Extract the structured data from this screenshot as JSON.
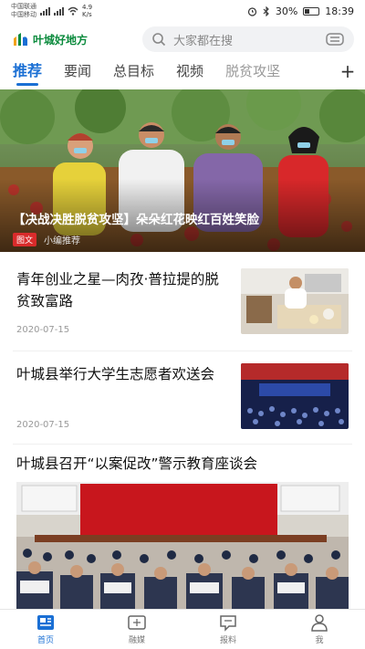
{
  "status_bar": {
    "carrier_top": "中国联通",
    "carrier_bottom": "中国移动",
    "speed": "4.9 K/s",
    "battery": "30%",
    "time": "18:39"
  },
  "header": {
    "logo_text": "叶城好地方",
    "search_placeholder": "大家都在搜"
  },
  "tabs": [
    "推荐",
    "要闻",
    "总目标",
    "视频",
    "脱贫攻坚"
  ],
  "hero": {
    "title": "【决战决胜脱贫攻坚】朵朵红花映红百姓笑脸",
    "tag": "图文",
    "source": "小编推荐"
  },
  "news": [
    {
      "title": "青年创业之星—肉孜·普拉提的脱贫致富路",
      "date": "2020-07-15"
    },
    {
      "title": "叶城县举行大学生志愿者欢送会",
      "date": "2020-07-15"
    },
    {
      "title": "叶城县召开“以案促改”警示教育座谈会"
    }
  ],
  "bottom_nav": [
    {
      "label": "首页",
      "icon": "home-icon"
    },
    {
      "label": "融媒",
      "icon": "media-icon"
    },
    {
      "label": "报料",
      "icon": "report-icon"
    },
    {
      "label": "我",
      "icon": "profile-icon"
    }
  ],
  "colors": {
    "accent": "#1a6fd4",
    "brand": "#0a8a3c",
    "tag_red": "#d92b2b"
  }
}
